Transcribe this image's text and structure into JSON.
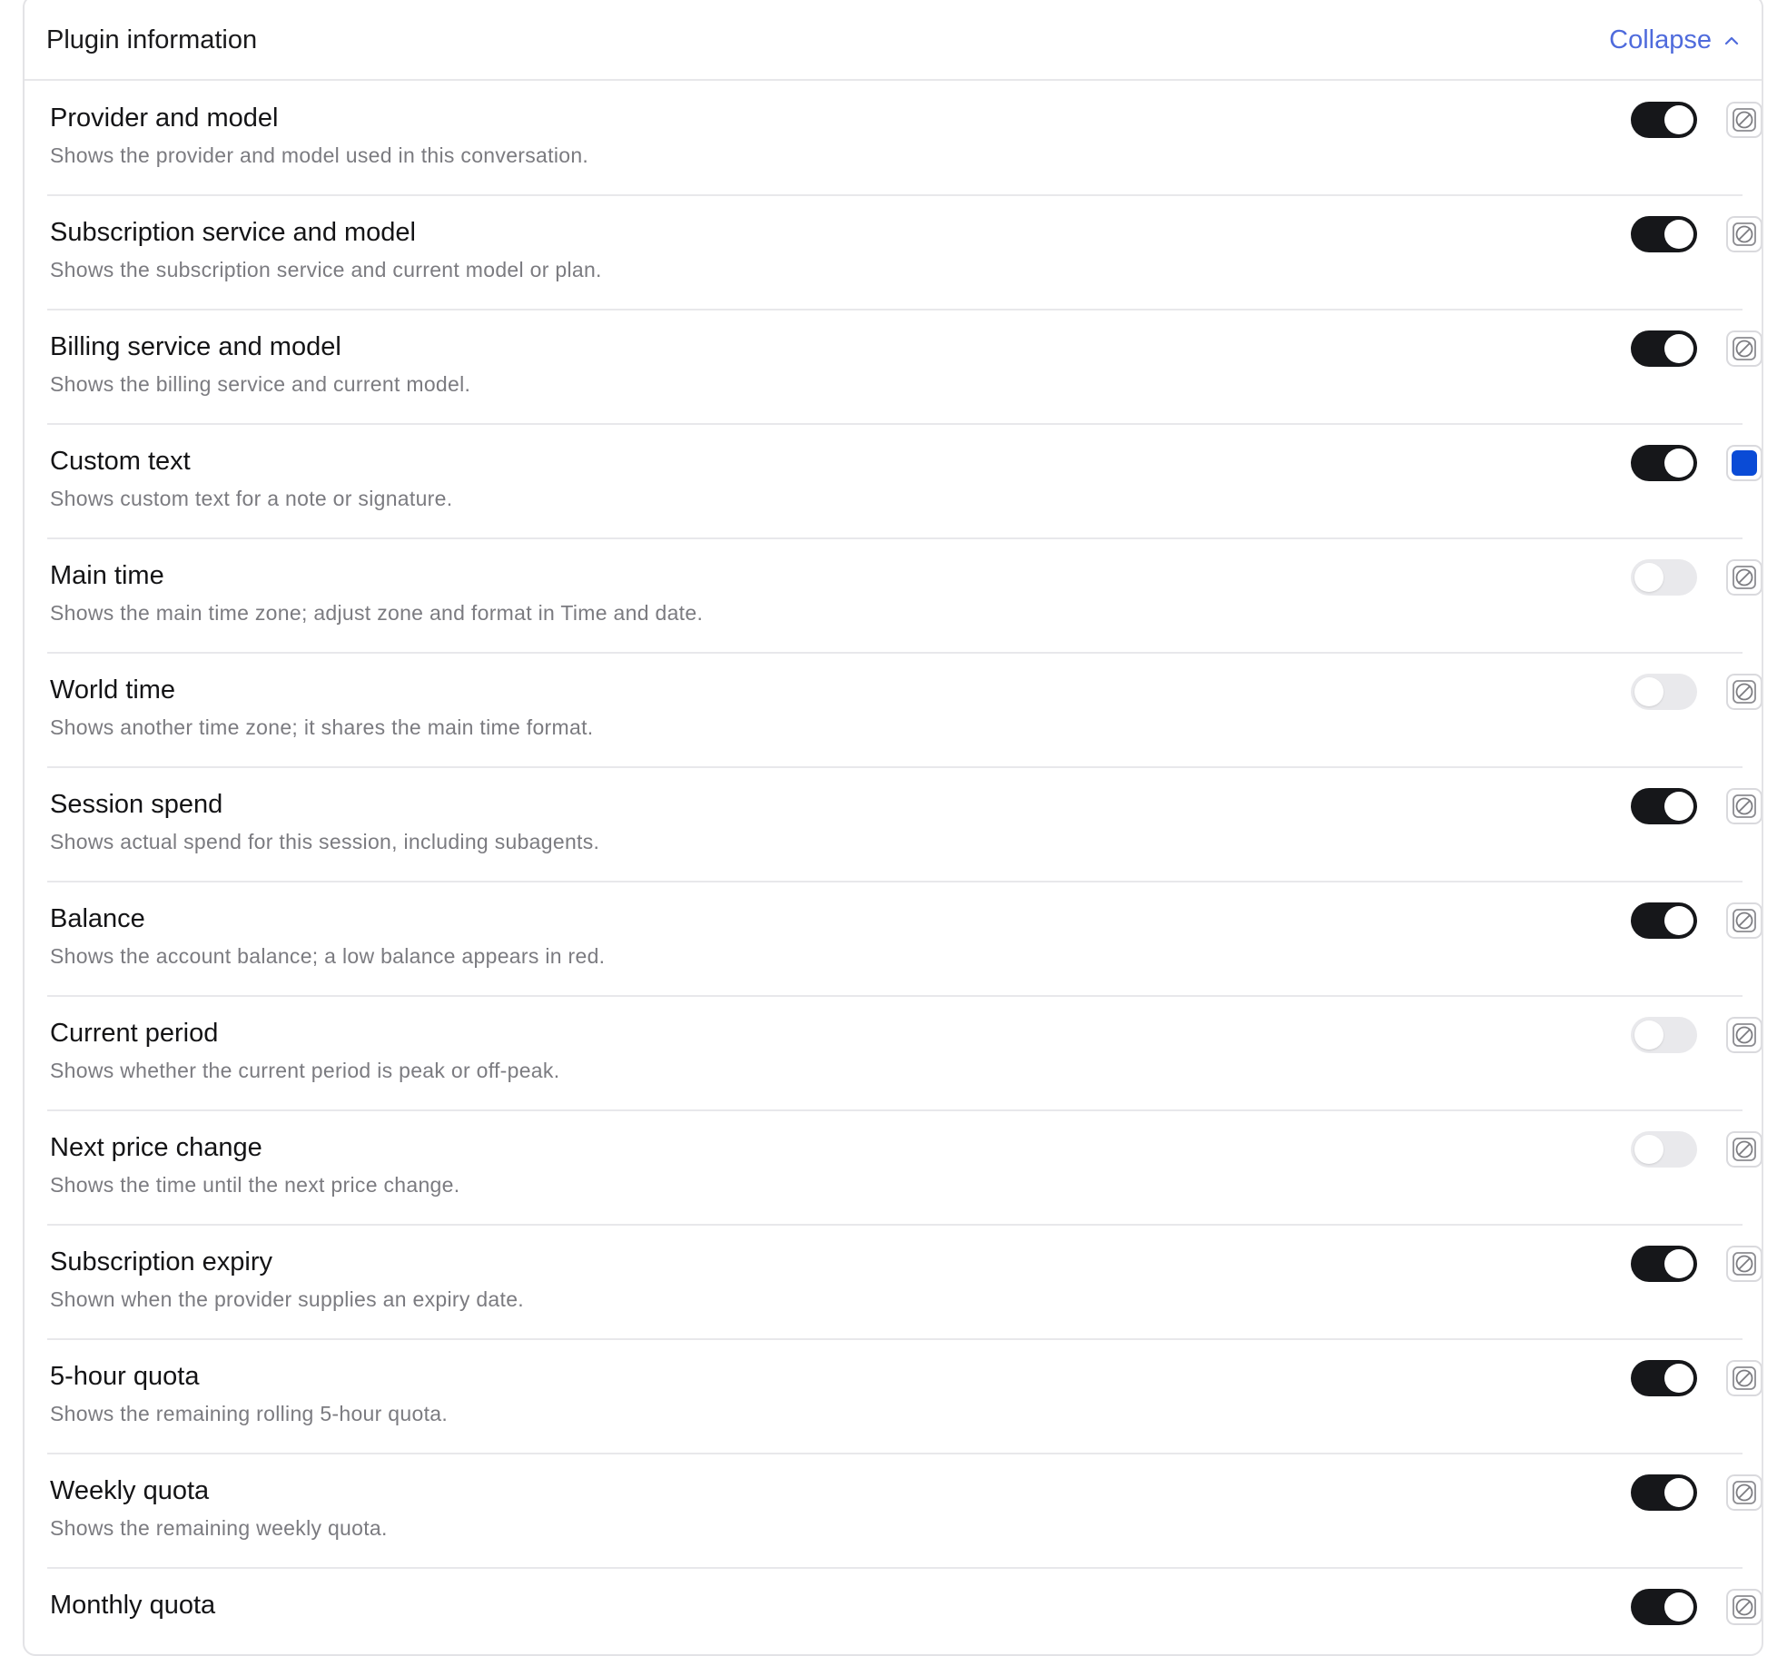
{
  "panel": {
    "title": "Plugin information",
    "collapse_label": "Collapse"
  },
  "items": [
    {
      "label": "Provider and model",
      "description": "Shows the provider and model used in this conversation.",
      "enabled": true,
      "color": null
    },
    {
      "label": "Subscription service and model",
      "description": "Shows the subscription service and current model or plan.",
      "enabled": true,
      "color": null
    },
    {
      "label": "Billing service and model",
      "description": "Shows the billing service and current model.",
      "enabled": true,
      "color": null
    },
    {
      "label": "Custom text",
      "description": "Shows custom text for a note or signature.",
      "enabled": true,
      "color": "#0a4bd6"
    },
    {
      "label": "Main time",
      "description": "Shows the main time zone; adjust zone and format in Time and date.",
      "enabled": false,
      "color": null
    },
    {
      "label": "World time",
      "description": "Shows another time zone; it shares the main time format.",
      "enabled": false,
      "color": null
    },
    {
      "label": "Session spend",
      "description": "Shows actual spend for this session, including subagents.",
      "enabled": true,
      "color": null
    },
    {
      "label": "Balance",
      "description": "Shows the account balance; a low balance appears in red.",
      "enabled": true,
      "color": null
    },
    {
      "label": "Current period",
      "description": "Shows whether the current period is peak or off-peak.",
      "enabled": false,
      "color": null
    },
    {
      "label": "Next price change",
      "description": "Shows the time until the next price change.",
      "enabled": false,
      "color": null
    },
    {
      "label": "Subscription expiry",
      "description": "Shown when the provider supplies an expiry date.",
      "enabled": true,
      "color": null
    },
    {
      "label": "5-hour quota",
      "description": "Shows the remaining rolling 5-hour quota.",
      "enabled": true,
      "color": null
    },
    {
      "label": "Weekly quota",
      "description": "Shows the remaining weekly quota.",
      "enabled": true,
      "color": null
    },
    {
      "label": "Monthly quota",
      "description": "",
      "enabled": true,
      "color": null
    }
  ],
  "icons": {
    "collapse": "chevron-up-icon",
    "no_color": "no-color-icon"
  },
  "colors": {
    "accent": "#4f6bdc",
    "toggle_on": "#16171a",
    "toggle_off": "#e9e9ec"
  }
}
